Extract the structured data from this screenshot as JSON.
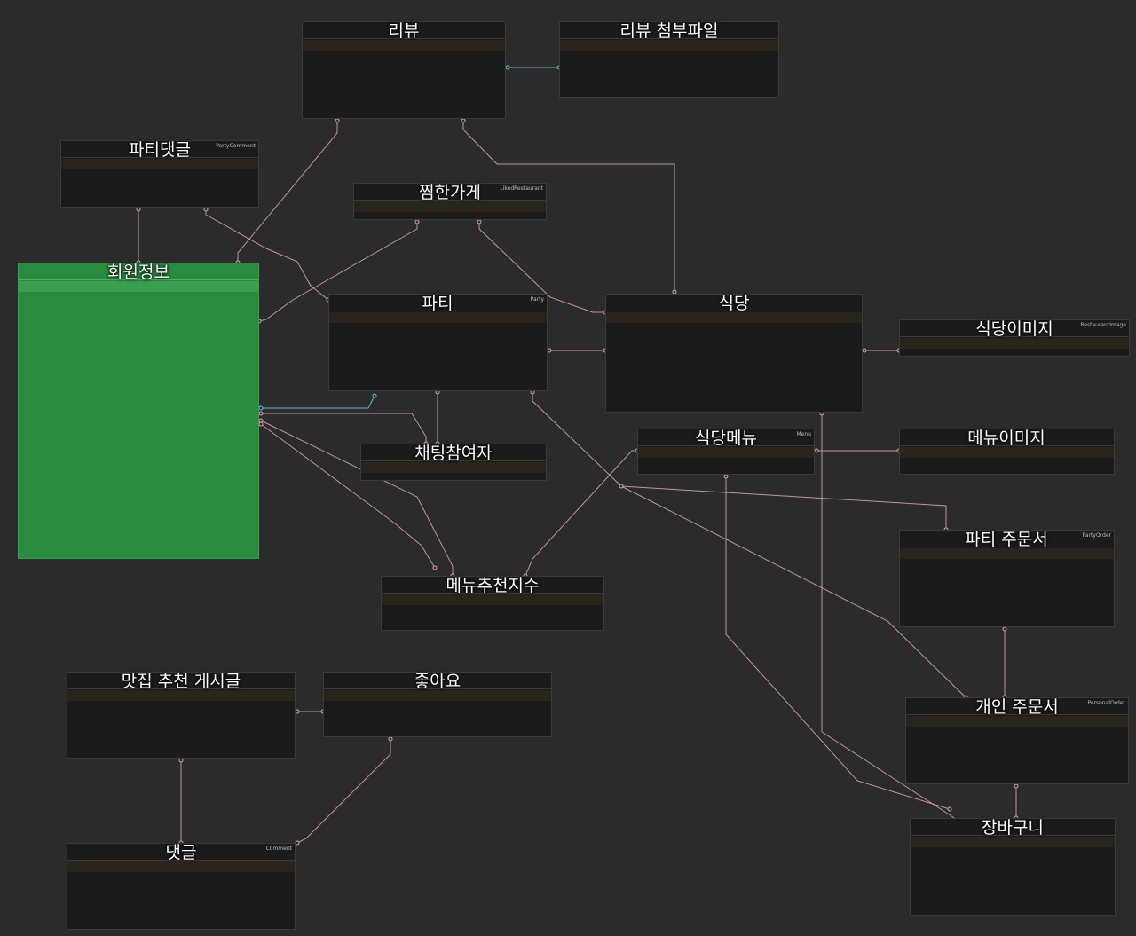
{
  "diagram": {
    "entities": [
      {
        "id": "review",
        "title": "리뷰",
        "physical_label": "",
        "logical_label": ""
      },
      {
        "id": "review_attachment",
        "title": "리뷰 첨부파일",
        "physical_label": "",
        "logical_label": ""
      },
      {
        "id": "party_comment",
        "title": "파티댓글",
        "physical_label": "",
        "logical_label": "PartyComment"
      },
      {
        "id": "liked_restaurant",
        "title": "찜한가게",
        "physical_label": "",
        "logical_label": "LikedRestaurant"
      },
      {
        "id": "member",
        "title": "회원정보",
        "physical_label": "",
        "logical_label": "",
        "highlighted": true
      },
      {
        "id": "party",
        "title": "파티",
        "physical_label": "",
        "logical_label": "Party"
      },
      {
        "id": "restaurant",
        "title": "식당",
        "physical_label": "",
        "logical_label": ""
      },
      {
        "id": "restaurant_image",
        "title": "식당이미지",
        "physical_label": "",
        "logical_label": "RestaurantImage"
      },
      {
        "id": "chat_participant",
        "title": "채팅참여자",
        "physical_label": "",
        "logical_label": ""
      },
      {
        "id": "restaurant_menu",
        "title": "식당메뉴",
        "physical_label": "",
        "logical_label": "Menu"
      },
      {
        "id": "menu_image",
        "title": "메뉴이미지",
        "physical_label": "",
        "logical_label": ""
      },
      {
        "id": "party_order",
        "title": "파티 주문서",
        "physical_label": "",
        "logical_label": "PartyOrder"
      },
      {
        "id": "menu_recommend",
        "title": "메뉴추천지수",
        "physical_label": "",
        "logical_label": ""
      },
      {
        "id": "recommend_post",
        "title": "맛집 추천 게시글",
        "physical_label": "",
        "logical_label": ""
      },
      {
        "id": "like",
        "title": "좋아요",
        "physical_label": "",
        "logical_label": ""
      },
      {
        "id": "personal_order",
        "title": "개인 주문서",
        "physical_label": "",
        "logical_label": "PersonalOrder"
      },
      {
        "id": "comment",
        "title": "댓글",
        "physical_label": "",
        "logical_label": "Comment"
      },
      {
        "id": "cart",
        "title": "장바구니",
        "physical_label": "",
        "logical_label": ""
      }
    ]
  }
}
